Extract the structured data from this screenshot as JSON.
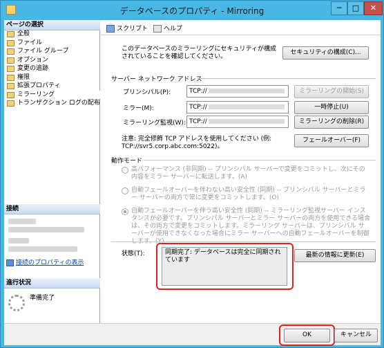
{
  "window": {
    "title": "データベースのプロパティ - Mirroring",
    "minimize_glyph": "─",
    "maximize_glyph": "□",
    "close_glyph": "✕"
  },
  "sidebar": {
    "pages_header": "ページの選択",
    "items": [
      {
        "label": "全般",
        "icon": "page-icon"
      },
      {
        "label": "ファイル",
        "icon": "page-icon"
      },
      {
        "label": "ファイル グループ",
        "icon": "page-icon"
      },
      {
        "label": "オプション",
        "icon": "page-icon"
      },
      {
        "label": "変更の追跡",
        "icon": "page-icon"
      },
      {
        "label": "権限",
        "icon": "page-icon"
      },
      {
        "label": "拡張プロパティ",
        "icon": "page-icon"
      },
      {
        "label": "ミラーリング",
        "icon": "page-icon"
      },
      {
        "label": "トランザクション ログの配布",
        "icon": "page-icon"
      }
    ],
    "connection_header": "接続",
    "connection_link": "接続のプロパティの表示",
    "progress_header": "進行状況",
    "progress_status": "準備完了"
  },
  "toolbar": {
    "script_label": "スクリプト",
    "script_dropdown_glyph": "▾",
    "help_label": "ヘルプ"
  },
  "security": {
    "description": "このデータベースのミラーリングにセキュリティが構成されていることを確認してください。",
    "configure_button": "セキュリティの構成(C)..."
  },
  "network": {
    "section_label": "サーバー ネットワーク アドレス",
    "principal_label": "プリンシパル(P):",
    "principal_value": "TCP://",
    "mirror_label": "ミラー(M):",
    "mirror_value": "TCP://",
    "witness_label": "ミラーリング監視(W):",
    "witness_value": "TCP://",
    "start_button": "ミラーリングの開始(S)",
    "pause_button": "一時停止(U)",
    "remove_button": "ミラーリングの削除(R)",
    "failover_button": "フェールオーバー(F)",
    "note": "注意: 完全修飾 TCP アドレスを使用してください (例: TCP://svr5.corp.abc.com:5022)。"
  },
  "operating_mode": {
    "section_label": "動作モード",
    "options": [
      {
        "text": "高パフォーマンス (非同期) -- プリンシパル サーバーで変更をコミットし、次にその内容をミラー サーバーに転送します。(A)",
        "selected": false
      },
      {
        "text": "自動フェールオーバーを伴わない高い安全性 (同期) -- プリンシパル サーバーとミラー サーバーの両方で常に変更をコミットします。(O)",
        "selected": false
      },
      {
        "text": "自動フェールオーバーを伴う高い安全性 (同期) -- ミラーリング監視サーバー インスタンスが必要です。プリンシパル サーバーとミラー サーバーの両方を使用できる場合は、その両方で変更をコミットします。ミラーリング サーバーは、プリンシパル サーバーが使用できなくなった場合にミラー サーバーへの自動フェールオーバーを制御します。(Y)",
        "selected": true
      }
    ]
  },
  "status": {
    "label": "状態(T):",
    "value": "同期完了: データベースは完全に同期されています",
    "refresh_button": "最新の情報に更新(E)"
  },
  "footer": {
    "ok_button": "OK",
    "cancel_button": "キャンセル"
  },
  "colors": {
    "titlebar": "#49b7e3",
    "highlight": "#e0201b",
    "link": "#0645ad"
  }
}
